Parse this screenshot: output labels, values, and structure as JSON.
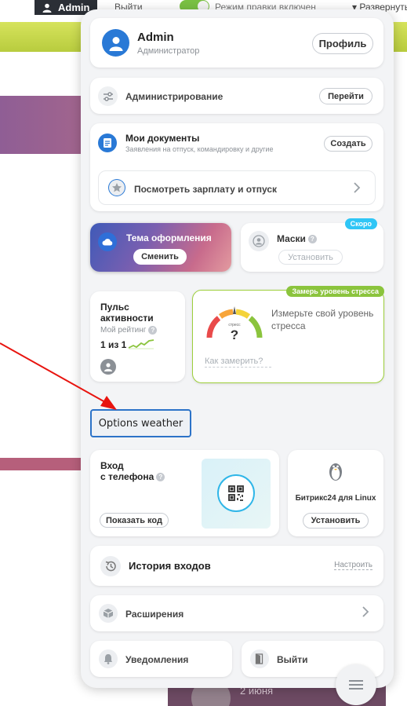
{
  "topbar": {
    "user": "Admin",
    "logout": "Выйти",
    "mode": "Режим правки включен",
    "expand": "Развернуть"
  },
  "background": {
    "date": "2 июня"
  },
  "profile": {
    "name": "Admin",
    "role": "Администратор",
    "profile_button": "Профиль"
  },
  "administration": {
    "label": "Администрирование",
    "button": "Перейти"
  },
  "documents": {
    "title": "Мои документы",
    "subtitle": "Заявления на отпуск, командировку и другие",
    "button": "Создать",
    "salary_link": "Посмотреть зарплату и отпуск"
  },
  "theme": {
    "title": "Тема оформления",
    "button": "Сменить"
  },
  "masks": {
    "title": "Маски",
    "badge": "Скоро",
    "button": "Установить"
  },
  "pulse": {
    "title_line1": "Пульс",
    "title_line2": "активности",
    "rating_label": "Мой рейтинг",
    "rank": "1 из 1"
  },
  "stress": {
    "tag": "Замерь уровень стресса",
    "gauge_label": "стресс",
    "gauge_value": "?",
    "text": "Измерьте свой уровень стресса",
    "how_link": "Как замерить?"
  },
  "weather": {
    "button": "Options weather"
  },
  "phone_login": {
    "title_line1": "Вход",
    "title_line2": "с телефона",
    "button": "Показать код"
  },
  "linux": {
    "title": "Битрикс24 для Linux",
    "button": "Установить"
  },
  "login_history": {
    "label": "История входов",
    "configure": "Настроить"
  },
  "extensions": {
    "label": "Расширения"
  },
  "notifications": {
    "label": "Уведомления"
  },
  "logout_card": {
    "label": "Выйти"
  },
  "colors": {
    "accent_blue": "#2979d6",
    "stress_green": "#8bc43d",
    "soon_badge": "#2fc6f6",
    "arrow_red": "#e8140f"
  }
}
